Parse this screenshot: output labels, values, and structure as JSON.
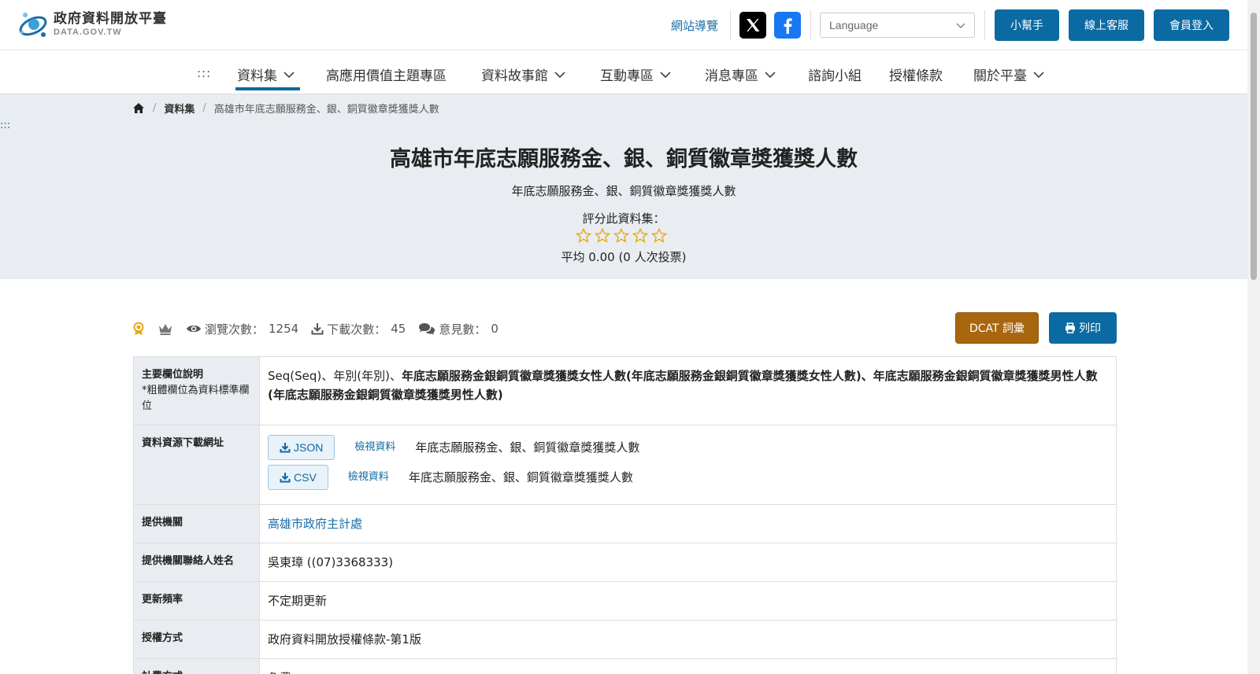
{
  "header": {
    "logo_cn": "政府資料開放平臺",
    "logo_en": "DATA.GOV.TW",
    "sitemap_label": "網站導覽",
    "language_placeholder": "Language",
    "helper_label": "小幫手",
    "support_label": "線上客服",
    "login_label": "會員登入"
  },
  "nav": {
    "accesskey": ":::",
    "items": [
      {
        "label": "資料集",
        "has_dropdown": true,
        "active": true
      },
      {
        "label": "高應用價值主題專區",
        "has_dropdown": false
      },
      {
        "label": "資料故事館",
        "has_dropdown": true
      },
      {
        "label": "互動專區",
        "has_dropdown": true
      },
      {
        "label": "消息專區",
        "has_dropdown": true
      },
      {
        "label": "諮詢小組",
        "has_dropdown": false
      },
      {
        "label": "授權條款",
        "has_dropdown": false
      },
      {
        "label": "關於平臺",
        "has_dropdown": true
      }
    ]
  },
  "hero": {
    "accesskey": ":::",
    "breadcrumb": [
      "資料集",
      "高雄市年底志願服務金、銀、銅質徽章獎獲獎人數"
    ],
    "title": "高雄市年底志願服務金、銀、銅質徽章獎獲獎人數",
    "subtitle": "年底志願服務金、銀、銅質徽章獎獲獎人數",
    "rate_label": "評分此資料集：",
    "rating": 0,
    "rating_max": 5,
    "average_text": "平均 0.00 (0 人次投票)"
  },
  "stats": {
    "views_label": "瀏覽次數：",
    "views": "1254",
    "downloads_label": "下載次數：",
    "downloads": "45",
    "comments_label": "意見數：",
    "comments": "0"
  },
  "actions": {
    "dcat_label": "DCAT 詞彙",
    "print_label": "列印"
  },
  "table": {
    "fields_header": "主要欄位說明",
    "fields_note": "*粗體欄位為資料標準欄位",
    "fields_plain": "Seq(Seq)、年別(年別)、",
    "fields_bold": "年底志願服務金銀銅質徽章獎獲獎女性人數(年底志願服務金銀銅質徽章獎獲獎女性人數)、年底志願服務金銀銅質徽章獎獲獎男性人數(年底志願服務金銀銅質徽章獎獲獎男性人數)",
    "resources_header": "資料資源下載網址",
    "resources": [
      {
        "format": "JSON",
        "view_label": "檢視資料",
        "name": "年底志願服務金、銀、銅質徽章獎獲獎人數"
      },
      {
        "format": "CSV",
        "view_label": "檢視資料",
        "name": "年底志願服務金、銀、銅質徽章獎獲獎人數"
      }
    ],
    "agency_header": "提供機關",
    "agency": "高雄市政府主計處",
    "contact_header": "提供機關聯絡人姓名",
    "contact": "吳東璋 ((07)3368333)",
    "frequency_header": "更新頻率",
    "frequency": "不定期更新",
    "license_header": "授權方式",
    "license": "政府資料開放授權條款-第1版",
    "fee_header": "計費方式",
    "fee": "免費"
  },
  "colors": {
    "brand": "#0b6aa2",
    "dcat": "#a8670f",
    "hero_bg": "#e9edf1",
    "star": "#e6a817"
  }
}
